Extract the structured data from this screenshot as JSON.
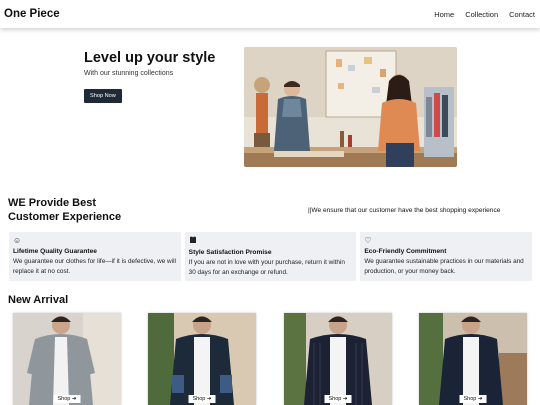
{
  "nav": {
    "brand": "One Piece",
    "links": [
      "Home",
      "Collection",
      "Contact"
    ]
  },
  "hero": {
    "title": "Level up your style",
    "subtitle": "With our stunning collections",
    "button": "Shop Now"
  },
  "experience": {
    "title": "WE Provide Best Customer Experience",
    "side_text": "||We ensure that our customer have the best shopping experience"
  },
  "features": [
    {
      "icon": "smile-icon",
      "title": "Lifetime Quality Guarantee",
      "text": "We guarantee our clothes for life—if it is defective, we will replace it at no cost."
    },
    {
      "icon": "shirt-icon",
      "title": "Style Satisfaction Promise",
      "text": "If you are not in love with your purchase, return it within 30 days for an exchange or refund."
    },
    {
      "icon": "heart-icon",
      "title": "Eco-Friendly Commitment",
      "text": "We guarantee sustainable practices in our materials and production, or your money back."
    }
  ],
  "arrivals": {
    "title": "New Arrival",
    "shop_label": "Shop ➔"
  },
  "colors": {
    "button_dark": "#1f2a36",
    "feature_bg": "#eef0f3"
  }
}
